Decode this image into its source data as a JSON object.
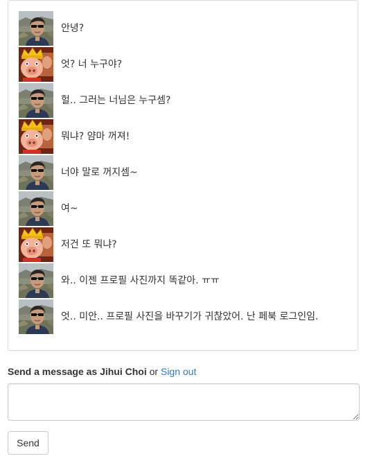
{
  "messages": [
    {
      "avatar": "man-with-sunglasses-avatar",
      "text": "안녕?"
    },
    {
      "avatar": "pig-king-avatar",
      "text": "엇? 너 누구야?"
    },
    {
      "avatar": "man-with-sunglasses-avatar",
      "text": "헐.. 그러는 너님은 누구셈?"
    },
    {
      "avatar": "pig-king-avatar",
      "text": "뭐냐? 얌마 꺼져!"
    },
    {
      "avatar": "man-with-sunglasses-avatar",
      "text": "너야 말로 꺼지셈~"
    },
    {
      "avatar": "man-with-sunglasses-avatar",
      "text": "여~"
    },
    {
      "avatar": "pig-king-avatar",
      "text": "저건 또 뭐냐?"
    },
    {
      "avatar": "man-with-sunglasses-avatar",
      "text": "와.. 이젠 프로필 사진까지 똑같아. ㅠㅠ"
    },
    {
      "avatar": "man-with-sunglasses-avatar",
      "text": "엇.. 미안.. 프로필 사진을 바꾸기가 귀찮았어. 난 페북 로그인임."
    }
  ],
  "compose": {
    "label_prefix": "Send a message as",
    "user_name": "Jihui Choi",
    "or_text": "or",
    "sign_out_label": "Sign out",
    "textarea_value": "",
    "send_label": "Send"
  },
  "colors": {
    "link": "#337ab7",
    "border": "#dddddd",
    "text": "#333333"
  }
}
